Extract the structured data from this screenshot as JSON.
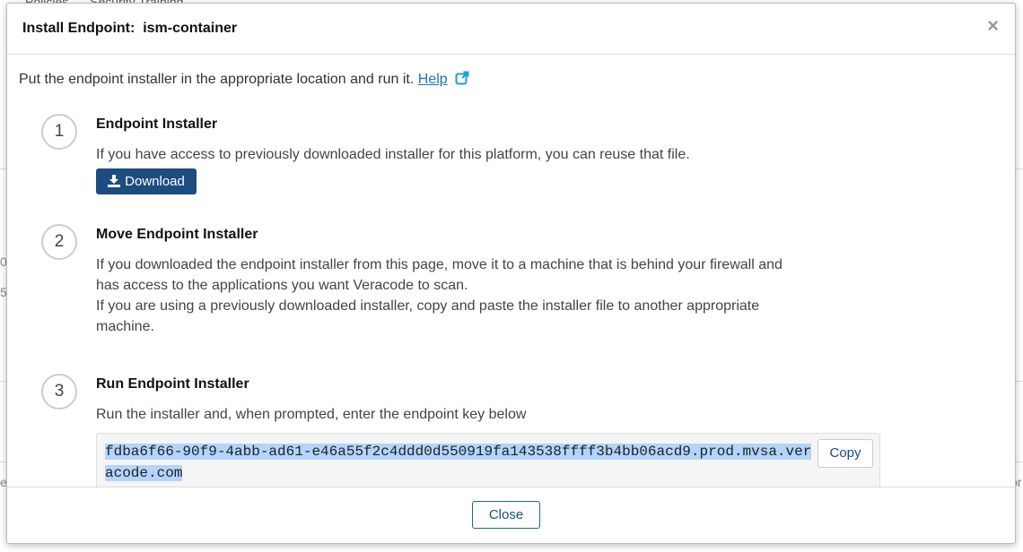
{
  "background": {
    "tabs": [
      "Policies",
      "Security Training"
    ],
    "fragments": [
      "0",
      "5",
      "e",
      "or"
    ]
  },
  "modal": {
    "title": "Install Endpoint:  ism-container",
    "close_icon": "×",
    "intro": "Put the endpoint installer in the appropriate location and run it.",
    "help_link": "Help",
    "steps": [
      {
        "number": "1",
        "title": "Endpoint Installer",
        "text": "If you have access to previously downloaded installer for this platform, you can reuse that file.",
        "button": "Download"
      },
      {
        "number": "2",
        "title": "Move Endpoint Installer",
        "text_lines": [
          "If you downloaded the endpoint installer from this page, move it to a machine that is behind your firewall and",
          "has access to the applications you want Veracode to scan.",
          "If you are using a previously downloaded installer, copy and paste the installer file to another appropriate",
          "machine."
        ]
      },
      {
        "number": "3",
        "title": "Run Endpoint Installer",
        "text": "Run the installer and, when prompted, enter the endpoint key below",
        "key": "fdba6f66-90f9-4abb-ad61-e46a55f2c4ddd0d550919fa143538ffff3b4bb06acd9.prod.mvsa.veracode.com",
        "copy_button": "Copy"
      }
    ],
    "footer_button": "Close"
  },
  "colors": {
    "primary": "#1c4c80",
    "link": "#1a73c8",
    "selection": "#b3d4fc"
  }
}
